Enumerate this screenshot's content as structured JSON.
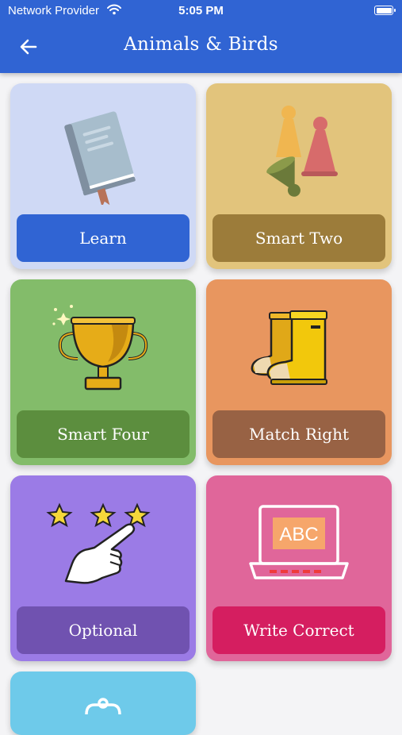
{
  "status_bar": {
    "carrier": "Network Provider",
    "time": "5:05 PM"
  },
  "header": {
    "title": "Animals & Birds",
    "back_icon": "arrow-left-icon",
    "background": "#3064d3"
  },
  "cards": [
    {
      "label": "Learn",
      "icon": "book-icon",
      "bg": "#cfd9f5",
      "label_bg": "#3064d3"
    },
    {
      "label": "Smart Two",
      "icon": "game-pieces-icon",
      "bg": "#e2c47c",
      "label_bg": "#9c7c3a"
    },
    {
      "label": "Smart Four",
      "icon": "trophy-icon",
      "bg": "#83bc6a",
      "label_bg": "#5c8e3e"
    },
    {
      "label": "Match Right",
      "icon": "boots-icon",
      "bg": "#e8965f",
      "label_bg": "#986244"
    },
    {
      "label": "Optional",
      "icon": "hand-stars-icon",
      "bg": "#9b7be6",
      "label_bg": "#7052b0"
    },
    {
      "label": "Write Correct",
      "icon": "laptop-abc-icon",
      "bg": "#e0669a",
      "label_bg": "#d51e60",
      "screen_text": "ABC"
    },
    {
      "label": "",
      "icon": "partial-card-icon",
      "bg": "#6ecaea"
    }
  ]
}
